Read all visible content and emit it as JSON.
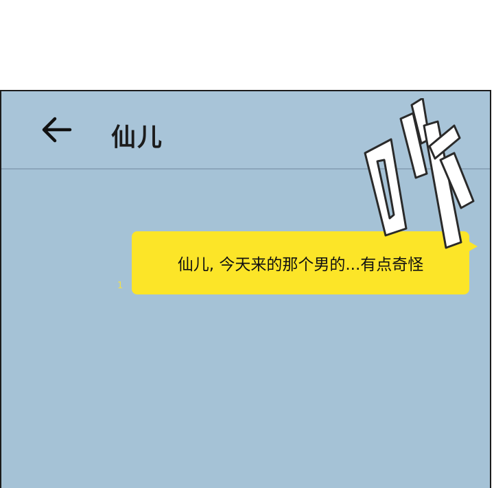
{
  "header": {
    "title": "仙儿",
    "back_icon": "arrow-left-icon"
  },
  "messages": [
    {
      "text": "仙儿, 今天来的那个男的...有点奇怪",
      "unread": "1",
      "sender": "self"
    }
  ],
  "sfx": {
    "text": "咻"
  },
  "colors": {
    "background": "#a5c2d6",
    "bubble": "#fce528",
    "unread": "#f2e04a"
  }
}
